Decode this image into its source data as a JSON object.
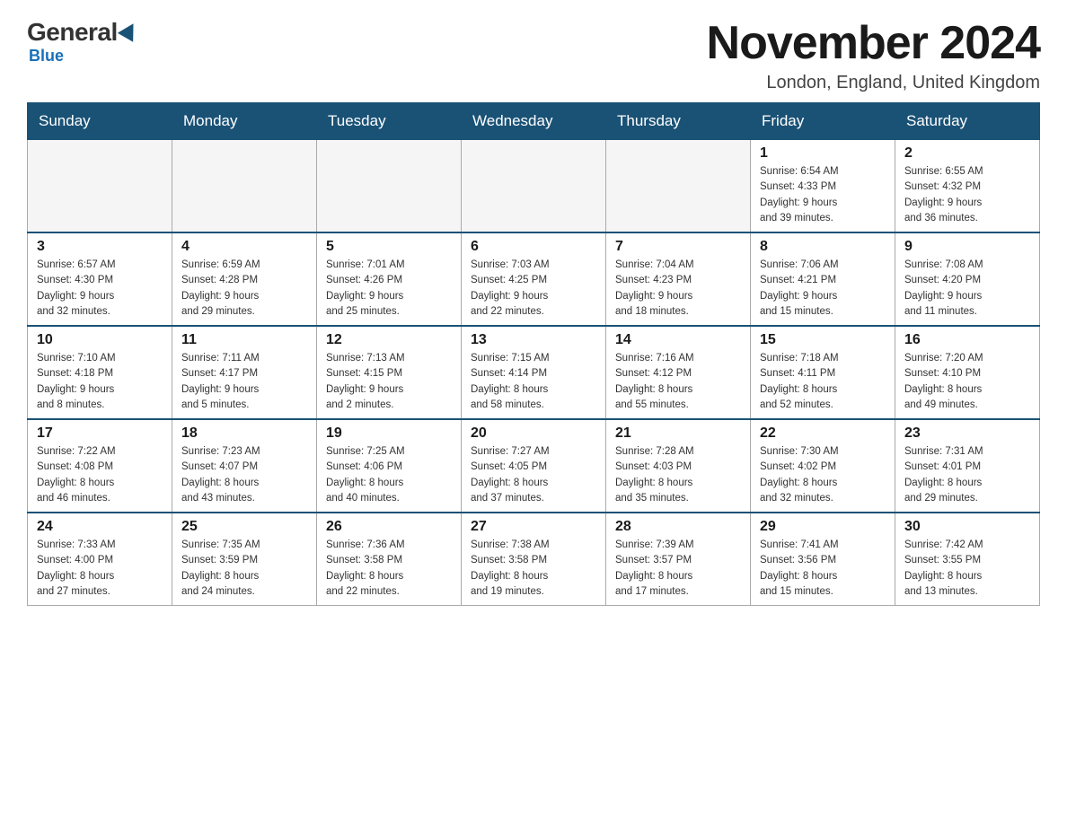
{
  "header": {
    "logo": {
      "general": "General",
      "blue": "Blue"
    },
    "title": "November 2024",
    "location": "London, England, United Kingdom"
  },
  "weekdays": [
    "Sunday",
    "Monday",
    "Tuesday",
    "Wednesday",
    "Thursday",
    "Friday",
    "Saturday"
  ],
  "weeks": [
    [
      {
        "day": "",
        "info": ""
      },
      {
        "day": "",
        "info": ""
      },
      {
        "day": "",
        "info": ""
      },
      {
        "day": "",
        "info": ""
      },
      {
        "day": "",
        "info": ""
      },
      {
        "day": "1",
        "info": "Sunrise: 6:54 AM\nSunset: 4:33 PM\nDaylight: 9 hours\nand 39 minutes."
      },
      {
        "day": "2",
        "info": "Sunrise: 6:55 AM\nSunset: 4:32 PM\nDaylight: 9 hours\nand 36 minutes."
      }
    ],
    [
      {
        "day": "3",
        "info": "Sunrise: 6:57 AM\nSunset: 4:30 PM\nDaylight: 9 hours\nand 32 minutes."
      },
      {
        "day": "4",
        "info": "Sunrise: 6:59 AM\nSunset: 4:28 PM\nDaylight: 9 hours\nand 29 minutes."
      },
      {
        "day": "5",
        "info": "Sunrise: 7:01 AM\nSunset: 4:26 PM\nDaylight: 9 hours\nand 25 minutes."
      },
      {
        "day": "6",
        "info": "Sunrise: 7:03 AM\nSunset: 4:25 PM\nDaylight: 9 hours\nand 22 minutes."
      },
      {
        "day": "7",
        "info": "Sunrise: 7:04 AM\nSunset: 4:23 PM\nDaylight: 9 hours\nand 18 minutes."
      },
      {
        "day": "8",
        "info": "Sunrise: 7:06 AM\nSunset: 4:21 PM\nDaylight: 9 hours\nand 15 minutes."
      },
      {
        "day": "9",
        "info": "Sunrise: 7:08 AM\nSunset: 4:20 PM\nDaylight: 9 hours\nand 11 minutes."
      }
    ],
    [
      {
        "day": "10",
        "info": "Sunrise: 7:10 AM\nSunset: 4:18 PM\nDaylight: 9 hours\nand 8 minutes."
      },
      {
        "day": "11",
        "info": "Sunrise: 7:11 AM\nSunset: 4:17 PM\nDaylight: 9 hours\nand 5 minutes."
      },
      {
        "day": "12",
        "info": "Sunrise: 7:13 AM\nSunset: 4:15 PM\nDaylight: 9 hours\nand 2 minutes."
      },
      {
        "day": "13",
        "info": "Sunrise: 7:15 AM\nSunset: 4:14 PM\nDaylight: 8 hours\nand 58 minutes."
      },
      {
        "day": "14",
        "info": "Sunrise: 7:16 AM\nSunset: 4:12 PM\nDaylight: 8 hours\nand 55 minutes."
      },
      {
        "day": "15",
        "info": "Sunrise: 7:18 AM\nSunset: 4:11 PM\nDaylight: 8 hours\nand 52 minutes."
      },
      {
        "day": "16",
        "info": "Sunrise: 7:20 AM\nSunset: 4:10 PM\nDaylight: 8 hours\nand 49 minutes."
      }
    ],
    [
      {
        "day": "17",
        "info": "Sunrise: 7:22 AM\nSunset: 4:08 PM\nDaylight: 8 hours\nand 46 minutes."
      },
      {
        "day": "18",
        "info": "Sunrise: 7:23 AM\nSunset: 4:07 PM\nDaylight: 8 hours\nand 43 minutes."
      },
      {
        "day": "19",
        "info": "Sunrise: 7:25 AM\nSunset: 4:06 PM\nDaylight: 8 hours\nand 40 minutes."
      },
      {
        "day": "20",
        "info": "Sunrise: 7:27 AM\nSunset: 4:05 PM\nDaylight: 8 hours\nand 37 minutes."
      },
      {
        "day": "21",
        "info": "Sunrise: 7:28 AM\nSunset: 4:03 PM\nDaylight: 8 hours\nand 35 minutes."
      },
      {
        "day": "22",
        "info": "Sunrise: 7:30 AM\nSunset: 4:02 PM\nDaylight: 8 hours\nand 32 minutes."
      },
      {
        "day": "23",
        "info": "Sunrise: 7:31 AM\nSunset: 4:01 PM\nDaylight: 8 hours\nand 29 minutes."
      }
    ],
    [
      {
        "day": "24",
        "info": "Sunrise: 7:33 AM\nSunset: 4:00 PM\nDaylight: 8 hours\nand 27 minutes."
      },
      {
        "day": "25",
        "info": "Sunrise: 7:35 AM\nSunset: 3:59 PM\nDaylight: 8 hours\nand 24 minutes."
      },
      {
        "day": "26",
        "info": "Sunrise: 7:36 AM\nSunset: 3:58 PM\nDaylight: 8 hours\nand 22 minutes."
      },
      {
        "day": "27",
        "info": "Sunrise: 7:38 AM\nSunset: 3:58 PM\nDaylight: 8 hours\nand 19 minutes."
      },
      {
        "day": "28",
        "info": "Sunrise: 7:39 AM\nSunset: 3:57 PM\nDaylight: 8 hours\nand 17 minutes."
      },
      {
        "day": "29",
        "info": "Sunrise: 7:41 AM\nSunset: 3:56 PM\nDaylight: 8 hours\nand 15 minutes."
      },
      {
        "day": "30",
        "info": "Sunrise: 7:42 AM\nSunset: 3:55 PM\nDaylight: 8 hours\nand 13 minutes."
      }
    ]
  ]
}
